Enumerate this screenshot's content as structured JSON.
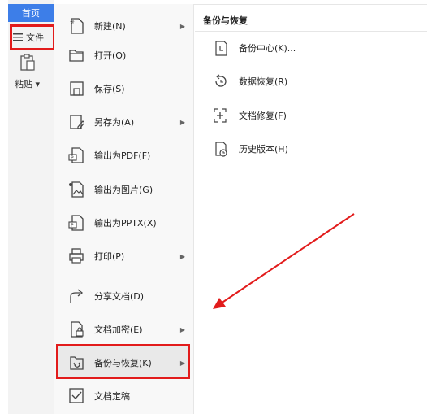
{
  "app": {
    "home_tab": "首页",
    "file_button": "文件",
    "paste_label": "粘贴"
  },
  "menu": {
    "items": [
      {
        "label": "新建(N)",
        "icon": "new-file-icon",
        "has_submenu": true
      },
      {
        "label": "打开(O)",
        "icon": "folder-open-icon",
        "has_submenu": false
      },
      {
        "label": "保存(S)",
        "icon": "save-icon",
        "has_submenu": false
      },
      {
        "label": "另存为(A)",
        "icon": "save-as-icon",
        "has_submenu": true
      },
      {
        "label": "输出为PDF(F)",
        "icon": "export-pdf-icon",
        "has_submenu": false
      },
      {
        "label": "输出为图片(G)",
        "icon": "export-image-icon",
        "has_submenu": false
      },
      {
        "label": "输出为PPTX(X)",
        "icon": "export-pptx-icon",
        "has_submenu": false
      },
      {
        "label": "打印(P)",
        "icon": "printer-icon",
        "has_submenu": true
      },
      {
        "label": "分享文档(D)",
        "icon": "share-icon",
        "has_submenu": false
      },
      {
        "label": "文档加密(E)",
        "icon": "encrypt-icon",
        "has_submenu": true
      },
      {
        "label": "备份与恢复(K)",
        "icon": "backup-icon",
        "has_submenu": true
      },
      {
        "label": "文档定稿",
        "icon": "finalize-icon",
        "has_submenu": false
      }
    ]
  },
  "submenu": {
    "title": "备份与恢复",
    "items": [
      {
        "label": "备份中心(K)...",
        "icon": "backup-center-icon"
      },
      {
        "label": "数据恢复(R)",
        "icon": "data-restore-icon"
      },
      {
        "label": "文档修复(F)",
        "icon": "doc-repair-icon"
      },
      {
        "label": "历史版本(H)",
        "icon": "history-version-icon"
      }
    ]
  },
  "colors": {
    "accent": "#3d7ee8",
    "highlight": "#e21b1b"
  }
}
